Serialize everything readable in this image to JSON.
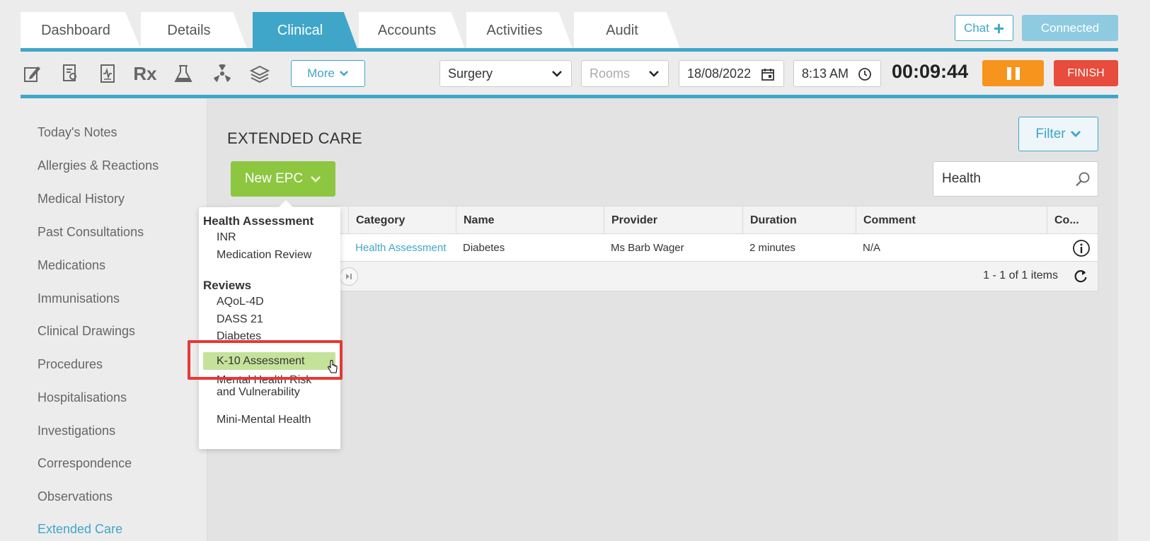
{
  "tabs": [
    {
      "label": "Dashboard",
      "active": false
    },
    {
      "label": "Details",
      "active": false
    },
    {
      "label": "Clinical",
      "active": true
    },
    {
      "label": "Accounts",
      "active": false
    },
    {
      "label": "Activities",
      "active": false
    },
    {
      "label": "Audit",
      "active": false
    }
  ],
  "header": {
    "chat_label": "Chat",
    "connected_label": "Connected"
  },
  "toolbar": {
    "icons": [
      "notes-icon",
      "certificate-icon",
      "report-icon",
      "prescription-icon",
      "pathology-icon",
      "radiology-icon",
      "books-icon"
    ],
    "rx_glyph": "Rx",
    "more_label": "More",
    "location_value": "Surgery",
    "rooms_placeholder": "Rooms",
    "date_value": "18/08/2022",
    "time_value": "8:13 AM",
    "timer_value": "00:09:44",
    "finish_label": "FINISH"
  },
  "sidebar": {
    "items": [
      {
        "label": "Today's Notes",
        "active": false
      },
      {
        "label": "Allergies & Reactions",
        "active": false
      },
      {
        "label": "Medical History",
        "active": false
      },
      {
        "label": "Past Consultations",
        "active": false
      },
      {
        "label": "Medications",
        "active": false
      },
      {
        "label": "Immunisations",
        "active": false
      },
      {
        "label": "Clinical Drawings",
        "active": false
      },
      {
        "label": "Procedures",
        "active": false
      },
      {
        "label": "Hospitalisations",
        "active": false
      },
      {
        "label": "Investigations",
        "active": false
      },
      {
        "label": "Correspondence",
        "active": false
      },
      {
        "label": "Observations",
        "active": false
      },
      {
        "label": "Extended Care",
        "active": true
      }
    ]
  },
  "main": {
    "title": "EXTENDED CARE",
    "filter_label": "Filter",
    "new_epc_label": "New EPC",
    "search_value": "Health",
    "table": {
      "columns": [
        "Category",
        "Name",
        "Provider",
        "Duration",
        "Comment",
        "Co..."
      ],
      "rows": [
        {
          "category": "Health Assessment",
          "name": "Diabetes",
          "provider": "Ms Barb Wager",
          "duration": "2 minutes",
          "comment": "N/A"
        }
      ],
      "pager_info": "1 - 1 of 1 items"
    }
  },
  "dropdown": {
    "groups": [
      {
        "label": "Health Assessment",
        "items": [
          "INR",
          "Medication Review"
        ]
      },
      {
        "label": "Reviews",
        "items": [
          "AQoL-4D",
          "DASS 21",
          "Diabetes",
          "K-10 Assessment",
          "Mental Health Risk and Vulnerability",
          "Mini-Mental Health"
        ]
      }
    ],
    "highlighted": "K-10 Assessment"
  },
  "colors": {
    "accent": "#3fa6c9",
    "green": "#8dc63f",
    "orange": "#f7941d",
    "red": "#e74c3c"
  }
}
